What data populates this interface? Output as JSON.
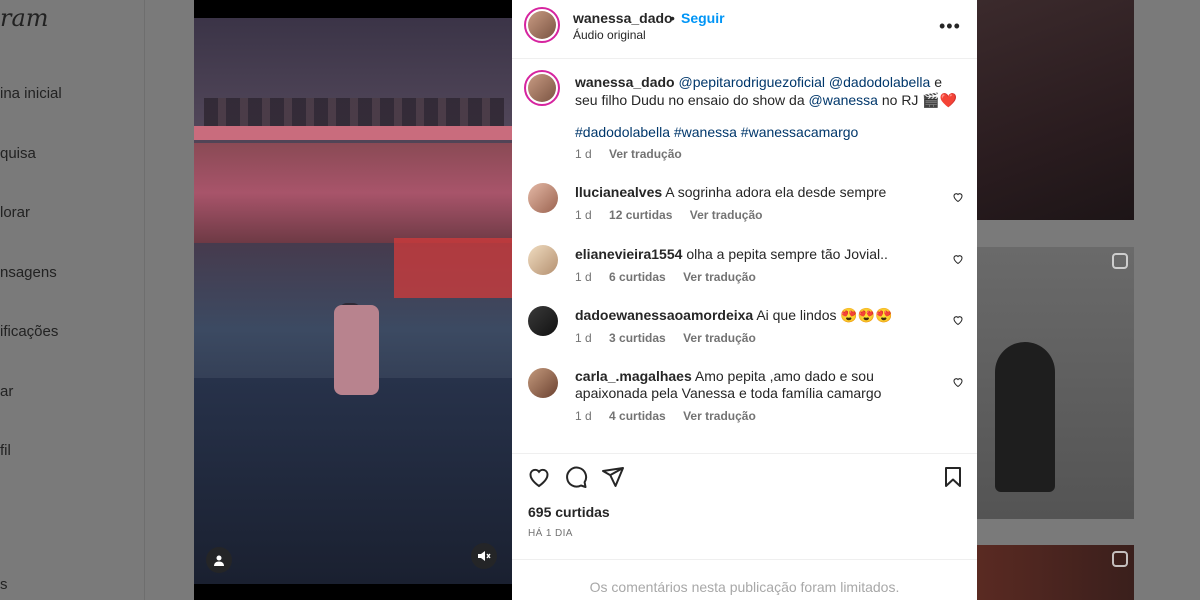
{
  "background": {
    "logo": "ram",
    "nav": [
      "ina inicial",
      "quisa",
      "lorar",
      "nsagens",
      "ificações",
      "ar",
      "fil",
      "s"
    ]
  },
  "post": {
    "header": {
      "username": "wanessa_dado",
      "separator": "•",
      "follow_label": "Seguir",
      "audio": "Áudio original"
    },
    "caption": {
      "username": "wanessa_dado",
      "parts": [
        "@pepitarodriguezoficial",
        " ",
        "@dadodolabella",
        " e seu filho Dudu no ensaio do show da ",
        "@wanessa",
        " no RJ 🎬❤️"
      ],
      "hashtags": "#dadodolabella #wanessa #wanessacamargo",
      "age": "1 d",
      "translate": "Ver tradução"
    },
    "comments": [
      {
        "username": "llucianealves",
        "text": "A sogrinha adora ela desde sempre",
        "age": "1 d",
        "likes": "12 curtidas",
        "translate": "Ver tradução"
      },
      {
        "username": "elianevieira1554",
        "text": "olha a pepita sempre tão Jovial..",
        "age": "1 d",
        "likes": "6 curtidas",
        "translate": "Ver tradução"
      },
      {
        "username": "dadoewanessaoamordeixa",
        "text": "Ai que lindos 😍😍😍",
        "age": "1 d",
        "likes": "3 curtidas",
        "translate": "Ver tradução"
      },
      {
        "username": "carla_.magalhaes",
        "text": "Amo pepita ,amo dado e sou apaixonada pela Vanessa e toda família camargo",
        "age": "1 d",
        "likes": "4 curtidas",
        "translate": "Ver tradução"
      }
    ],
    "likes_count": "695 curtidas",
    "posted": "HÁ 1 DIA",
    "comments_limited": "Os comentários nesta publicação foram limitados.",
    "icons": {
      "more": "more-options-icon",
      "like": "heart-icon",
      "comment": "comment-icon",
      "share": "share-icon",
      "save": "bookmark-icon",
      "user_tag": "user-tag-icon",
      "mute": "muted-speaker-icon"
    }
  }
}
